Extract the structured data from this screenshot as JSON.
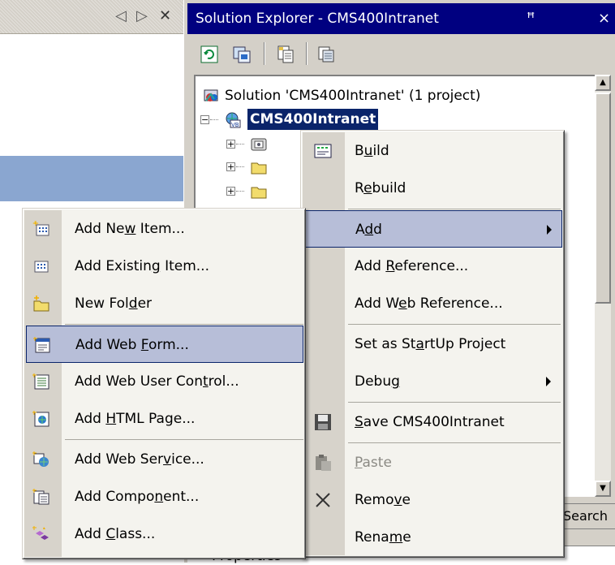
{
  "left_pane": {
    "buttons": [
      "◁",
      "▷",
      "✕"
    ]
  },
  "solution_explorer": {
    "title": "Solution Explorer - CMS400Intranet",
    "pin_glyph": "†",
    "tree": {
      "solution_label": "Solution 'CMS400Intranet' (1 project)",
      "project_label": "CMS400Intranet"
    },
    "search_tab_label": "Search",
    "properties_label": "Properties"
  },
  "project_menu": [
    {
      "label": "Build",
      "mnemonic": "u",
      "icon": "build-icon"
    },
    {
      "label": "Rebuild",
      "mnemonic": "e",
      "icon": "none"
    },
    {
      "label": "Add",
      "mnemonic": "d",
      "icon": "none",
      "submenu": true,
      "highlighted": true
    },
    {
      "label": "Add Reference...",
      "mnemonic": "R",
      "icon": "none"
    },
    {
      "label": "Add Web Reference...",
      "mnemonic": "e",
      "icon": "none"
    },
    {
      "label": "Set as StartUp Project",
      "mnemonic": "a",
      "icon": "none"
    },
    {
      "label": "Debug",
      "mnemonic": "g",
      "icon": "none",
      "submenu": true
    },
    {
      "label": "Save CMS400Intranet",
      "mnemonic": "S",
      "icon": "save-icon"
    },
    {
      "label": "Paste",
      "mnemonic": "P",
      "icon": "paste-icon",
      "disabled": true
    },
    {
      "label": "Remove",
      "mnemonic": "v",
      "icon": "remove-icon"
    },
    {
      "label": "Rename",
      "mnemonic": "m",
      "icon": "none"
    }
  ],
  "add_submenu": [
    {
      "label": "Add New Item...",
      "icon": "new-item-icon"
    },
    {
      "label": "Add Existing Item...",
      "icon": "existing-item-icon"
    },
    {
      "label": "New Folder",
      "icon": "new-folder-icon"
    },
    {
      "label": "Add Web Form...",
      "icon": "web-form-icon",
      "highlighted": true
    },
    {
      "label": "Add Web User Control...",
      "icon": "web-user-control-icon"
    },
    {
      "label": "Add HTML Page...",
      "icon": "html-page-icon"
    },
    {
      "label": "Add Web Service...",
      "icon": "web-service-icon"
    },
    {
      "label": "Add Component...",
      "icon": "component-icon"
    },
    {
      "label": "Add Class...",
      "icon": "class-icon"
    }
  ],
  "colors": {
    "title_bar": "#000080",
    "highlight": "#b7bed8",
    "selection": "#0a246a",
    "menu_bg": "#f4f3ee"
  }
}
